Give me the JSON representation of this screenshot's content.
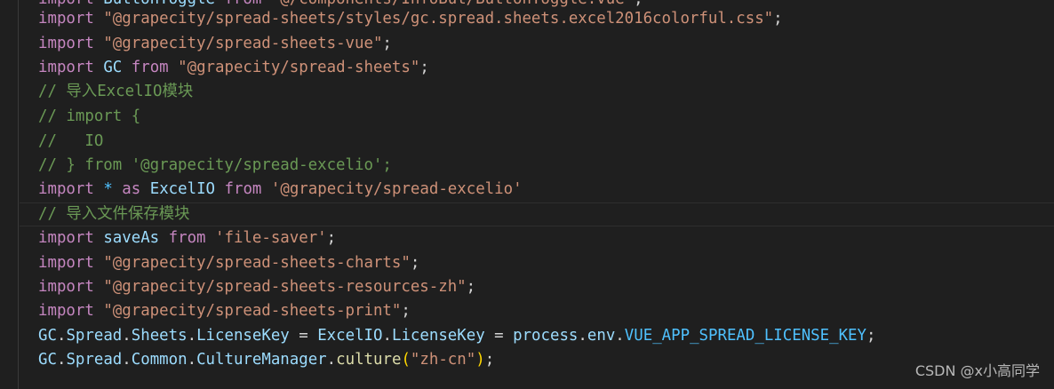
{
  "editor": {
    "line0": {
      "t1": "import",
      "t2": " ButtonToggle ",
      "t3": "from",
      "t4": " ",
      "t5": "'@/components/InfoBut/ButtonToggle.vue'",
      "t6": ";"
    },
    "line1": {
      "t1": "import",
      "t2": " ",
      "t3": "\"@grapecity/spread-sheets/styles/gc.spread.sheets.excel2016colorful.css\"",
      "t4": ";"
    },
    "line2": {
      "t1": "import",
      "t2": " ",
      "t3": "\"@grapecity/spread-sheets-vue\"",
      "t4": ";"
    },
    "line3": {
      "t1": "import",
      "t2": " ",
      "t3": "GC",
      "t4": " ",
      "t5": "from",
      "t6": " ",
      "t7": "\"@grapecity/spread-sheets\"",
      "t8": ";"
    },
    "line4": {
      "t1": "// 导入ExcelIO模块"
    },
    "line5": {
      "t1": "// import {"
    },
    "line6": {
      "t1": "//   IO"
    },
    "line7": {
      "t1": "// } from '@grapecity/spread-excelio';"
    },
    "line8": {
      "t1": "import",
      "t2": " ",
      "t3": "*",
      "t4": " ",
      "t5": "as",
      "t6": " ",
      "t7": "ExcelIO",
      "t8": " ",
      "t9": "from",
      "t10": " ",
      "t11": "'@grapecity/spread-excelio'"
    },
    "line9": {
      "t1": "// 导入文件保存模块"
    },
    "line10": {
      "t1": "import",
      "t2": " ",
      "t3": "saveAs",
      "t4": " ",
      "t5": "from",
      "t6": " ",
      "t7": "'file-saver'",
      "t8": ";"
    },
    "line11": {
      "t1": "import",
      "t2": " ",
      "t3": "\"@grapecity/spread-sheets-charts\"",
      "t4": ";"
    },
    "line12": {
      "t1": "import",
      "t2": " ",
      "t3": "\"@grapecity/spread-sheets-resources-zh\"",
      "t4": ";"
    },
    "line13": {
      "t1": "import",
      "t2": " ",
      "t3": "\"@grapecity/spread-sheets-print\"",
      "t4": ";"
    },
    "line14": {
      "t1": "GC",
      "t2": ".",
      "t3": "Spread",
      "t4": ".",
      "t5": "Sheets",
      "t6": ".",
      "t7": "LicenseKey",
      "t8": " = ",
      "t9": "ExcelIO",
      "t10": ".",
      "t11": "LicenseKey",
      "t12": " = ",
      "t13": "process",
      "t14": ".",
      "t15": "env",
      "t16": ".",
      "t17": "VUE_APP_SPREAD_LICENSE_KEY",
      "t18": ";"
    },
    "line15": {
      "t1": "GC",
      "t2": ".",
      "t3": "Spread",
      "t4": ".",
      "t5": "Common",
      "t6": ".",
      "t7": "CultureManager",
      "t8": ".",
      "t9": "culture",
      "t10": "(",
      "t11": "\"zh-cn\"",
      "t12": ")",
      "t13": ";"
    }
  },
  "watermark": "CSDN @x小高同学",
  "colors": {
    "background": "#1f1f1f",
    "keyword": "#c586c0",
    "string": "#ce9178",
    "comment": "#6a9955",
    "variable": "#9cdcfe",
    "class": "#4ec9b0",
    "constant": "#4fc1ff",
    "function": "#dcdcaa",
    "punctuation": "#d4d4d4"
  }
}
